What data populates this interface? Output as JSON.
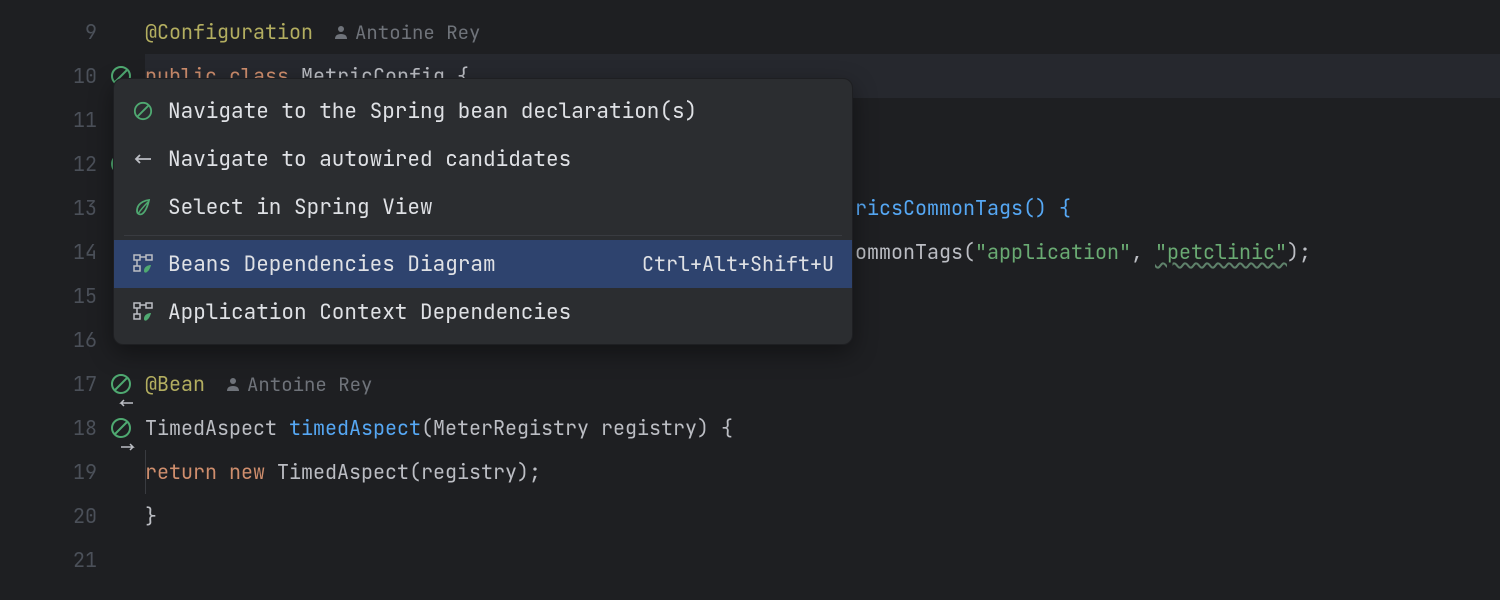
{
  "gutter": {
    "lines": [
      "9",
      "10",
      "11",
      "12",
      "13",
      "14",
      "15",
      "16",
      "17",
      "18",
      "19",
      "20",
      "21"
    ]
  },
  "code": {
    "annotation_configuration": "@Configuration",
    "author": "Antoine Rey",
    "public": "public",
    "class": "class",
    "class_name_partial": "MetricConfig",
    "brace_open": " {",
    "line13_suffix": "ricsCommonTags() {",
    "line14_suffix": "ommonTags(",
    "str_application": "\"application\"",
    "comma": ", ",
    "str_petclinic": "\"petclinic\"",
    "line14_end": ");",
    "annotation_bean": "@Bean",
    "type_timedaspect": "TimedAspect ",
    "method_timedaspect": "timedAspect",
    "params_open": "(",
    "type_meterregistry": "MeterRegistry ",
    "param_registry": "registry",
    "params_close": ") {",
    "kw_return": "return",
    "kw_new": " new",
    "ctor_call": " TimedAspect(registry);",
    "brace_close": "}"
  },
  "popup": {
    "items": [
      {
        "label": "Navigate to the Spring bean declaration(s)",
        "shortcut": ""
      },
      {
        "label": "Navigate to autowired candidates",
        "shortcut": ""
      },
      {
        "label": "Select in Spring View",
        "shortcut": ""
      },
      {
        "label": "Beans Dependencies Diagram",
        "shortcut": "Ctrl+Alt+Shift+U"
      },
      {
        "label": "Application Context Dependencies",
        "shortcut": ""
      }
    ]
  }
}
